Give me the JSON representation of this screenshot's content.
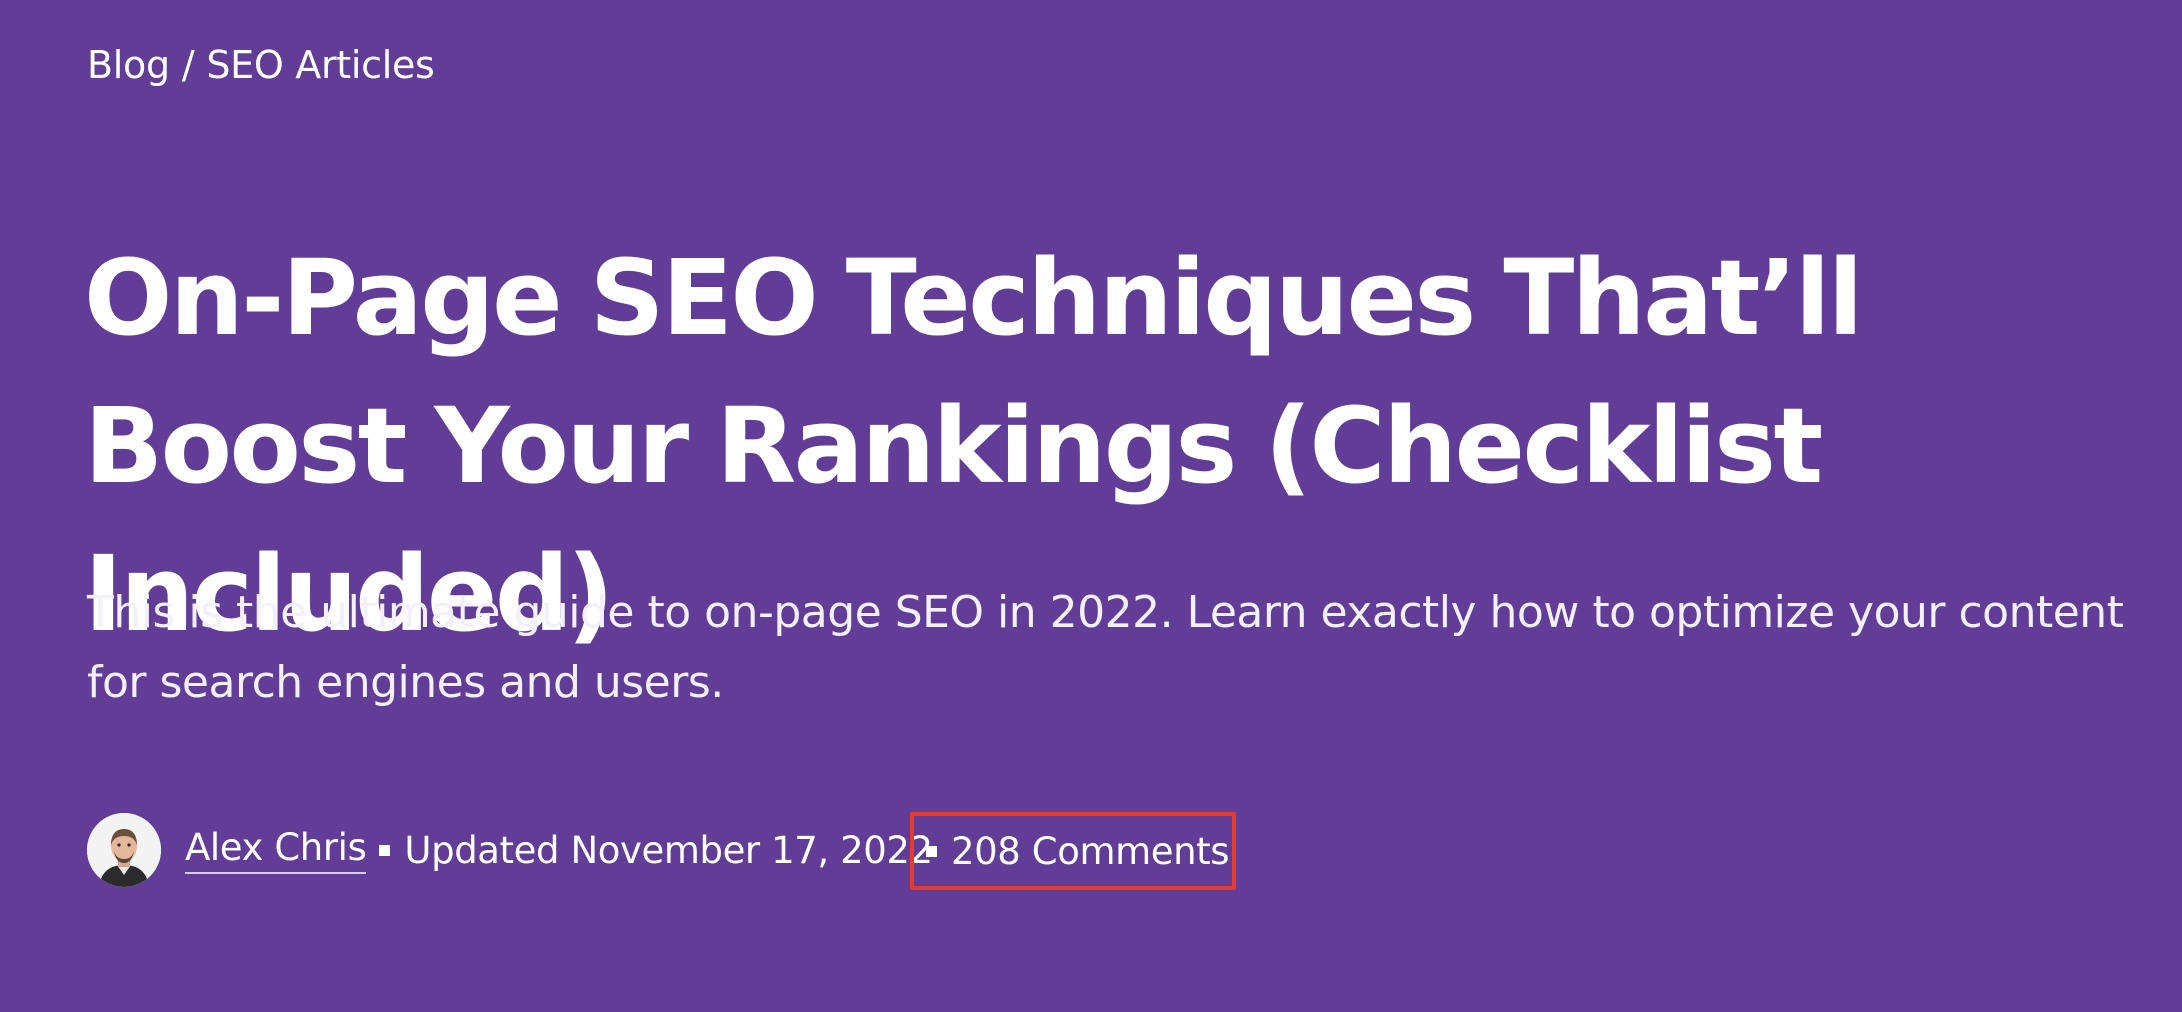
{
  "breadcrumb": {
    "items": [
      "Blog",
      "SEO Articles"
    ],
    "separator": "/"
  },
  "article": {
    "title": "On-Page SEO Techniques That’ll Boost Your Rankings (Checklist Included)",
    "subtitle": "This is the ultimate guide to on-page SEO in 2022. Learn exactly how to optimize your content for search engines and users."
  },
  "meta": {
    "author": "Alex Chris",
    "updated": "Updated November 17, 2022",
    "comments": "208 Comments",
    "avatar_icon": "author-avatar",
    "bullet_icon": "square-bullet-icon"
  },
  "colors": {
    "background": "#613d98",
    "text": "#ffffff",
    "highlight_box": "#e53a2c"
  }
}
